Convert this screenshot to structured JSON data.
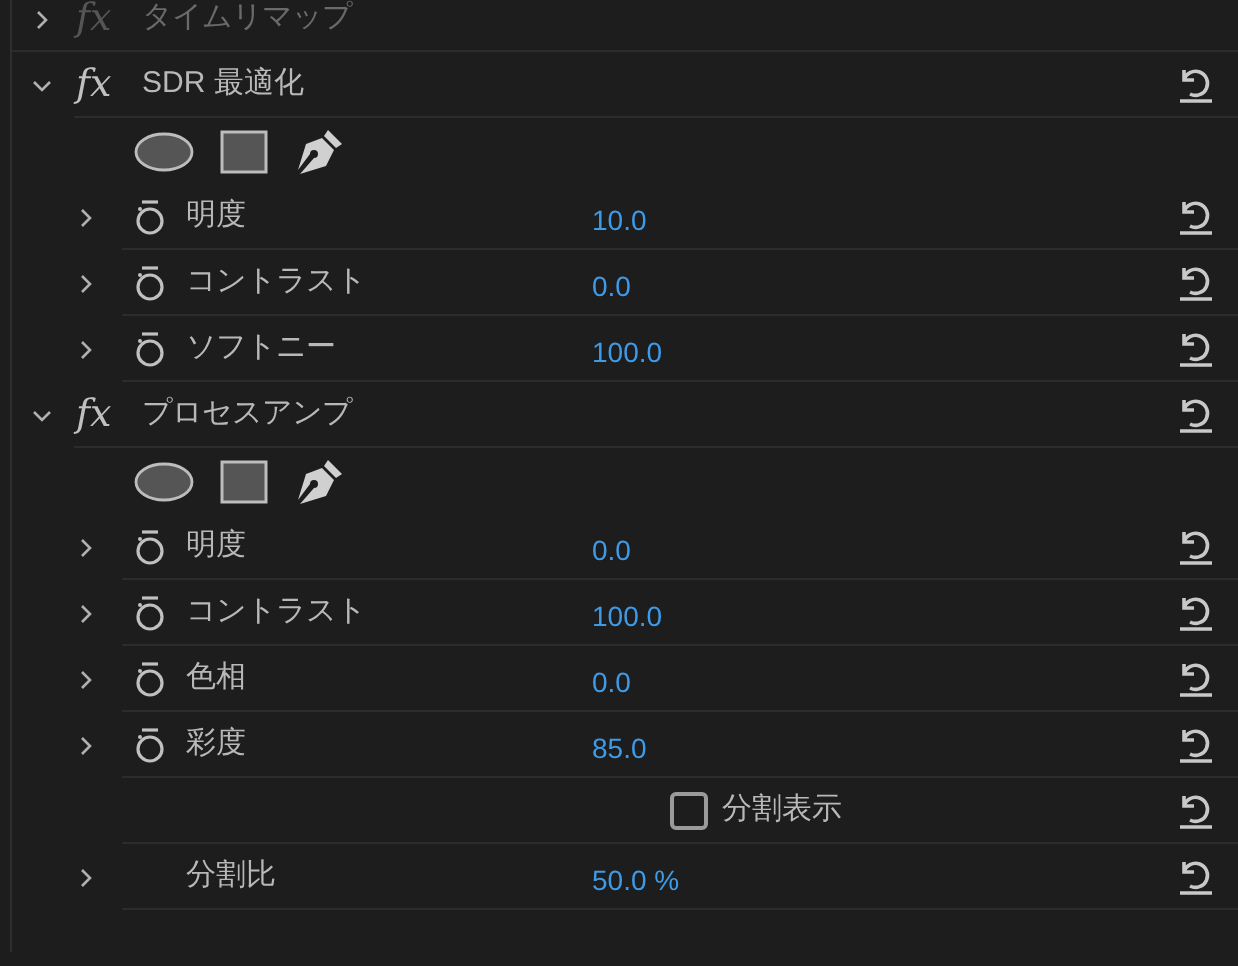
{
  "effects": [
    {
      "fx": "fx",
      "name": "タイムリマップ",
      "enabled": false,
      "expanded": false,
      "reset": false
    },
    {
      "fx": "fx",
      "name": "SDR 最適化",
      "enabled": true,
      "expanded": true,
      "masks": true,
      "reset": true,
      "params": [
        {
          "kind": "param",
          "label": "明度",
          "value": "10.0"
        },
        {
          "kind": "param",
          "label": "コントラスト",
          "value": "0.0"
        },
        {
          "kind": "param",
          "label": "ソフトニー",
          "value": "100.0"
        }
      ]
    },
    {
      "fx": "fx",
      "name": "プロセスアンプ",
      "enabled": true,
      "expanded": true,
      "masks": true,
      "reset": true,
      "params": [
        {
          "kind": "param",
          "label": "明度",
          "value": "0.0"
        },
        {
          "kind": "param",
          "label": "コントラスト",
          "value": "100.0"
        },
        {
          "kind": "param",
          "label": "色相",
          "value": "0.0"
        },
        {
          "kind": "param",
          "label": "彩度",
          "value": "85.0"
        },
        {
          "kind": "checkbox",
          "label": "分割表示",
          "checked": false
        },
        {
          "kind": "plain",
          "label": "分割比",
          "value": "50.0 %"
        }
      ]
    }
  ]
}
